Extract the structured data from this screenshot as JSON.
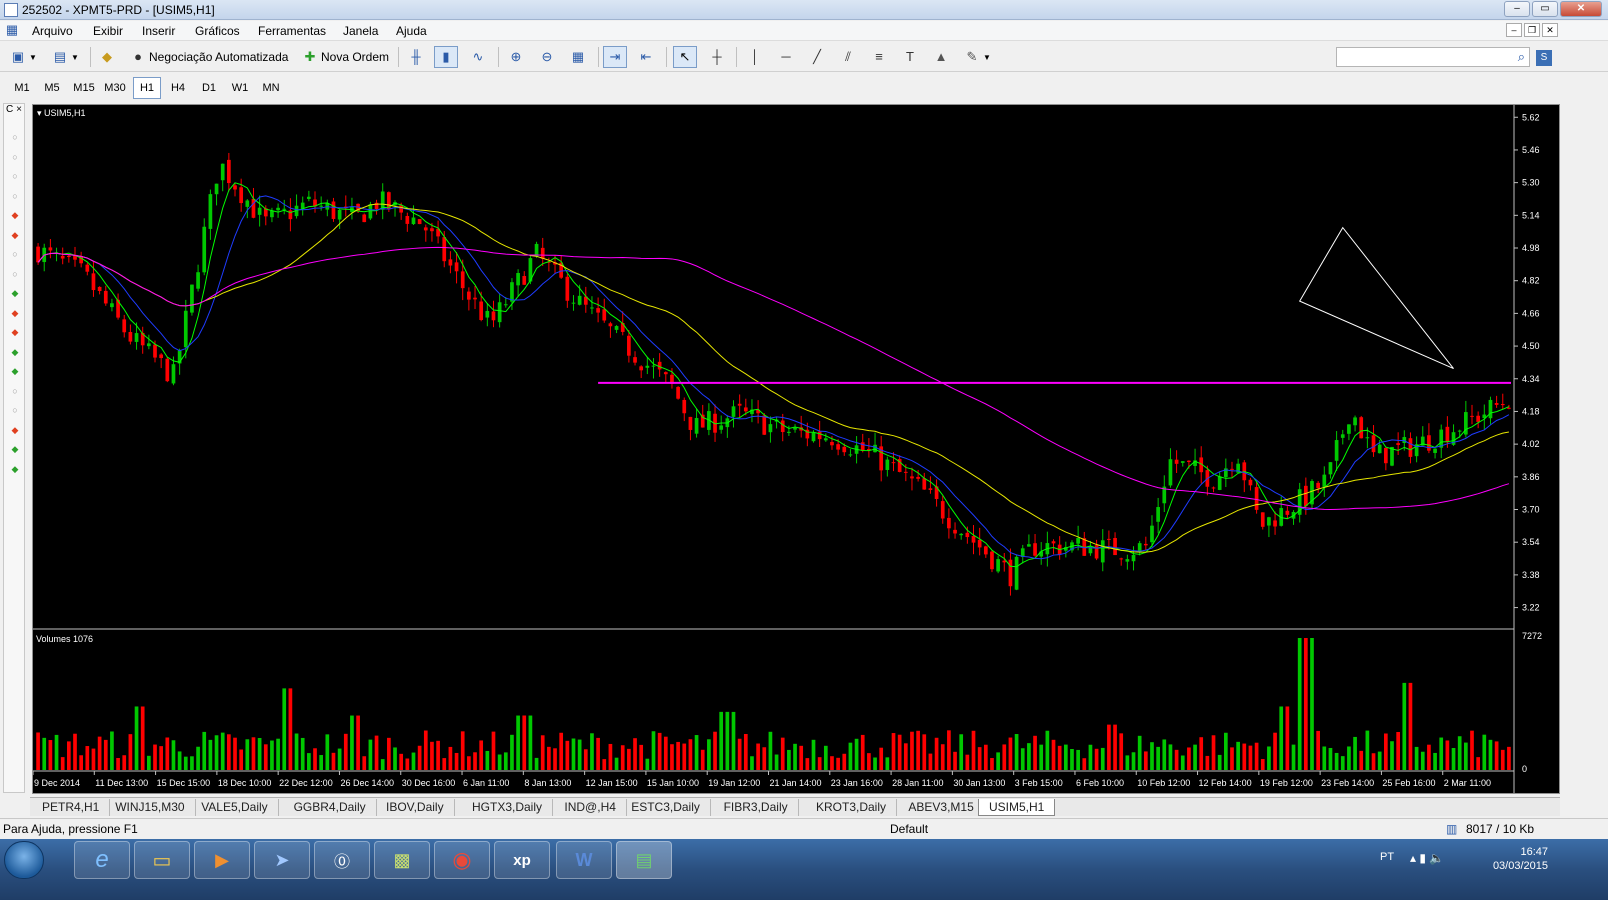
{
  "window": {
    "title": "252502 - XPMT5-PRD - [USIM5,H1]"
  },
  "menu": [
    "Arquivo",
    "Exibir",
    "Inserir",
    "Gráficos",
    "Ferramentas",
    "Janela",
    "Ajuda"
  ],
  "toolbar": {
    "auto_trading": "Negociação Automatizada",
    "new_order": "Nova Ordem"
  },
  "timeframes": [
    "M1",
    "M5",
    "M15",
    "M30",
    "H1",
    "H4",
    "D1",
    "W1",
    "MN"
  ],
  "active_timeframe": "H1",
  "left_panel": {
    "header_left": "C",
    "header_right": "×"
  },
  "chart": {
    "label": "USIM5,H1",
    "volume_label": "Volumes 1076",
    "price_axis": [
      "5.62",
      "5.46",
      "5.30",
      "5.14",
      "4.98",
      "4.82",
      "4.66",
      "4.50",
      "4.34",
      "4.18",
      "4.02",
      "3.86",
      "3.70",
      "3.54",
      "3.38",
      "3.22"
    ],
    "volume_axis": [
      "7272",
      "0"
    ],
    "date_axis": [
      "9 Dec 2014",
      "11 Dec 13:00",
      "15 Dec 15:00",
      "18 Dec 10:00",
      "22 Dec 12:00",
      "26 Dec 14:00",
      "30 Dec 16:00",
      "6 Jan 11:00",
      "8 Jan 13:00",
      "12 Jan 15:00",
      "15 Jan 10:00",
      "19 Jan 12:00",
      "21 Jan 14:00",
      "23 Jan 16:00",
      "28 Jan 11:00",
      "30 Jan 13:00",
      "3 Feb 15:00",
      "6 Feb 10:00",
      "10 Feb 12:00",
      "12 Feb 14:00",
      "19 Feb 12:00",
      "23 Feb 14:00",
      "25 Feb 16:00",
      "2 Mar 11:00"
    ],
    "colors": {
      "bull": "#00c800",
      "bear": "#ff0000",
      "ma_fast": "#00ff00",
      "ma_blue": "#1f3cff",
      "ma_yellow": "#e6e600",
      "ma_magenta": "#ff00ff",
      "hline": "#ff00ff"
    },
    "horizontal_line_price": 4.32
  },
  "chart_data": {
    "type": "candlestick",
    "symbol": "USIM5",
    "timeframe": "H1",
    "close_path": [
      [
        0,
        4.97
      ],
      [
        4,
        4.85
      ],
      [
        8,
        4.55
      ],
      [
        12,
        4.35
      ],
      [
        16,
        5.4
      ],
      [
        20,
        5.1
      ],
      [
        24,
        5.2
      ],
      [
        28,
        5.12
      ],
      [
        30,
        5.21
      ],
      [
        34,
        5.1
      ],
      [
        38,
        4.75
      ],
      [
        40,
        4.6
      ],
      [
        44,
        4.95
      ],
      [
        48,
        4.7
      ],
      [
        52,
        4.5
      ],
      [
        56,
        4.3
      ],
      [
        58,
        4.1
      ],
      [
        62,
        4.17
      ],
      [
        66,
        4.08
      ],
      [
        70,
        4.06
      ],
      [
        74,
        3.96
      ],
      [
        78,
        3.8
      ],
      [
        82,
        3.58
      ],
      [
        86,
        3.38
      ],
      [
        88,
        3.52
      ],
      [
        92,
        3.52
      ],
      [
        96,
        3.5
      ],
      [
        98,
        3.52
      ],
      [
        100,
        3.94
      ],
      [
        104,
        3.85
      ],
      [
        106,
        3.98
      ],
      [
        108,
        3.62
      ],
      [
        112,
        3.76
      ],
      [
        114,
        3.85
      ],
      [
        116,
        4.2
      ],
      [
        118,
        3.96
      ],
      [
        122,
        4.02
      ],
      [
        126,
        4.12
      ],
      [
        130,
        4.24
      ]
    ],
    "volume_peaks": [
      [
        9,
        3500
      ],
      [
        22,
        4500
      ],
      [
        28,
        3000
      ],
      [
        43,
        3000
      ],
      [
        61,
        3200
      ],
      [
        95,
        2500
      ],
      [
        110,
        3500
      ],
      [
        112,
        7272
      ],
      [
        121,
        4800
      ]
    ]
  },
  "tabs": [
    "PETR4,H1",
    "WINJ15,M30",
    "VALE5,Daily",
    "GGBR4,Daily",
    "IBOV,Daily",
    "HGTX3,Daily",
    "IND@,H4",
    "ESTC3,Daily",
    "FIBR3,Daily",
    "KROT3,Daily",
    "ABEV3,M15",
    "USIM5,H1"
  ],
  "active_tab": "USIM5,H1",
  "status": {
    "help": "Para Ajuda, pressione F1",
    "profile": "Default",
    "traffic": "8017 / 10 Kb"
  },
  "taskbar": {
    "lang": "PT",
    "time": "16:47",
    "date": "03/03/2015"
  }
}
